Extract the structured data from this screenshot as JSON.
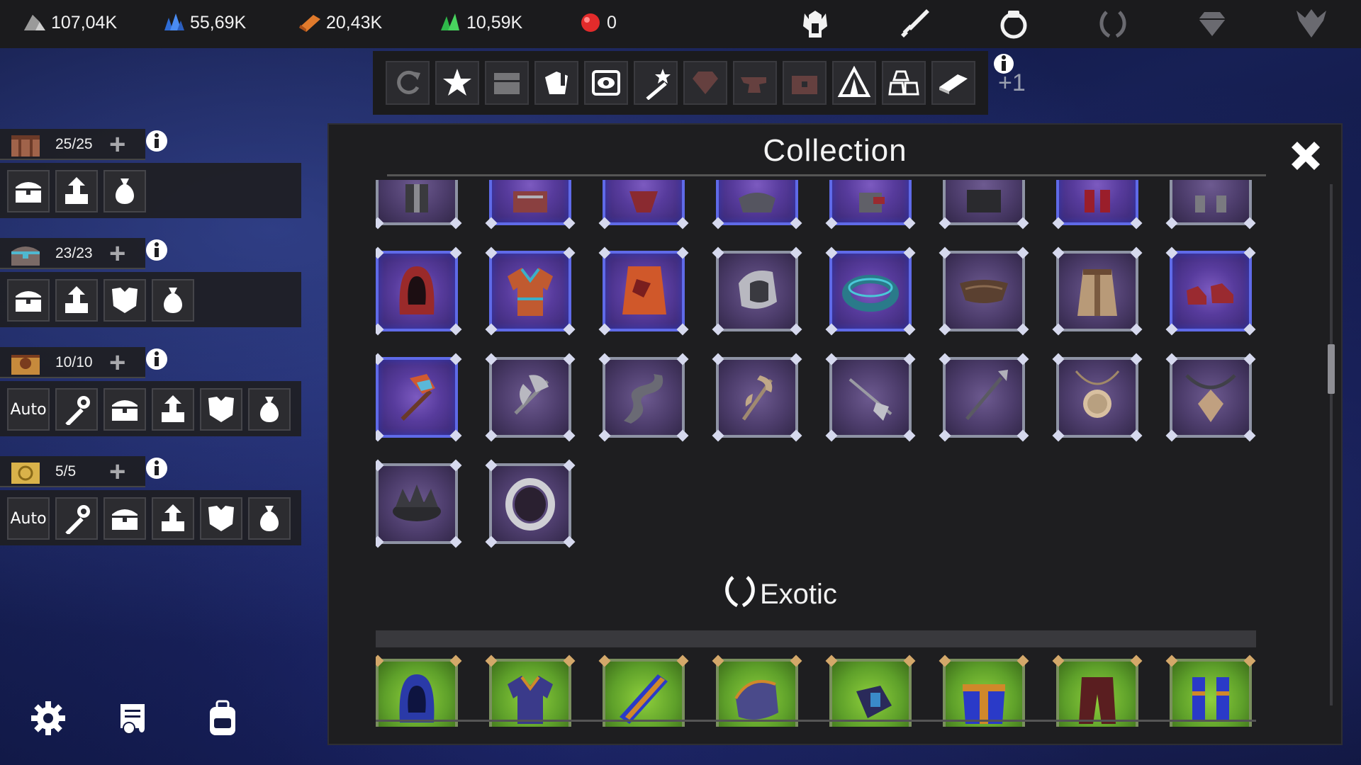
{
  "resources": [
    {
      "id": "silver",
      "value": "107,04K",
      "icon": "silver-ore-icon",
      "color": "#c9c9c9"
    },
    {
      "id": "blue",
      "value": "55,69K",
      "icon": "blue-crystal-icon",
      "color": "#3f7ee6"
    },
    {
      "id": "orange",
      "value": "20,43K",
      "icon": "orange-ingot-icon",
      "color": "#e07a2c"
    },
    {
      "id": "green",
      "value": "10,59K",
      "icon": "green-crystal-icon",
      "color": "#2fb84a"
    },
    {
      "id": "red",
      "value": "0",
      "icon": "red-gem-icon",
      "color": "#e22b2b"
    }
  ],
  "top_categories": [
    "helmet-icon",
    "sword-icon",
    "ring-icon",
    "laurel-icon",
    "diamond-icon",
    "winged-emblem-icon"
  ],
  "filters": [
    {
      "icon": "refresh-icon",
      "active": false
    },
    {
      "icon": "star-burst-icon",
      "active": true
    },
    {
      "icon": "chest-icon",
      "active": false
    },
    {
      "icon": "scroll-hand-icon",
      "active": true
    },
    {
      "icon": "eye-gear-icon",
      "active": true
    },
    {
      "icon": "wand-icon",
      "active": true
    },
    {
      "icon": "gem-icon",
      "active": false
    },
    {
      "icon": "anvil-icon",
      "active": false
    },
    {
      "icon": "treasure-chest-icon",
      "active": false
    },
    {
      "icon": "tent-icon",
      "active": true
    },
    {
      "icon": "stones-icon",
      "active": true
    },
    {
      "icon": "bar-icon",
      "active": true
    }
  ],
  "filter_extra": "+1",
  "inventories": [
    {
      "count": "25/25",
      "slots": [
        "chest",
        "arrow-up",
        "bag"
      ]
    },
    {
      "count": "23/23",
      "slots": [
        "chest",
        "arrow-up",
        "armor",
        "bag"
      ]
    },
    {
      "count": "10/10",
      "slots": [
        "auto",
        "wrench",
        "chest",
        "arrow-up",
        "armor",
        "bag"
      ]
    },
    {
      "count": "5/5",
      "slots": [
        "auto",
        "wrench",
        "chest",
        "arrow-up",
        "armor",
        "bag"
      ]
    }
  ],
  "auto_label": "Auto",
  "collection": {
    "title": "Collection",
    "section_exotic": "Exotic",
    "rows": [
      [
        "legendary-partial-helm",
        "legendary-partial-chest",
        "legendary-partial-cape",
        "legendary-partial-shoulder",
        "legendary-partial-gloves",
        "epic-partial-armor",
        "legendary-partial-pants",
        "epic-partial-boots"
      ],
      [
        "hood",
        "tunic",
        "cape",
        "pauldron",
        "bracelet",
        "belt",
        "skirt",
        "boots"
      ],
      [
        "war-hammer",
        "double-axe",
        "serpent-blade",
        "bone-staff",
        "trident",
        "spear",
        "amulet",
        "pendant"
      ],
      [
        "crown",
        "band-ring"
      ]
    ],
    "row_rarity": [
      [
        "epic",
        "legendary",
        "legendary",
        "legendary",
        "legendary",
        "epic",
        "legendary",
        "epic"
      ],
      [
        "legendary",
        "legendary",
        "legendary",
        "epic",
        "legendary",
        "epic",
        "epic",
        "legendary"
      ],
      [
        "legendary",
        "epic",
        "epic",
        "epic",
        "epic",
        "epic",
        "epic",
        "epic"
      ],
      [
        "epic",
        "epic"
      ]
    ],
    "exotic_row": [
      "blue-hood",
      "blue-tunic",
      "blue-cape",
      "blue-pauldron",
      "blue-gauntlet",
      "blue-robe",
      "maroon-pants",
      "blue-boots"
    ]
  }
}
